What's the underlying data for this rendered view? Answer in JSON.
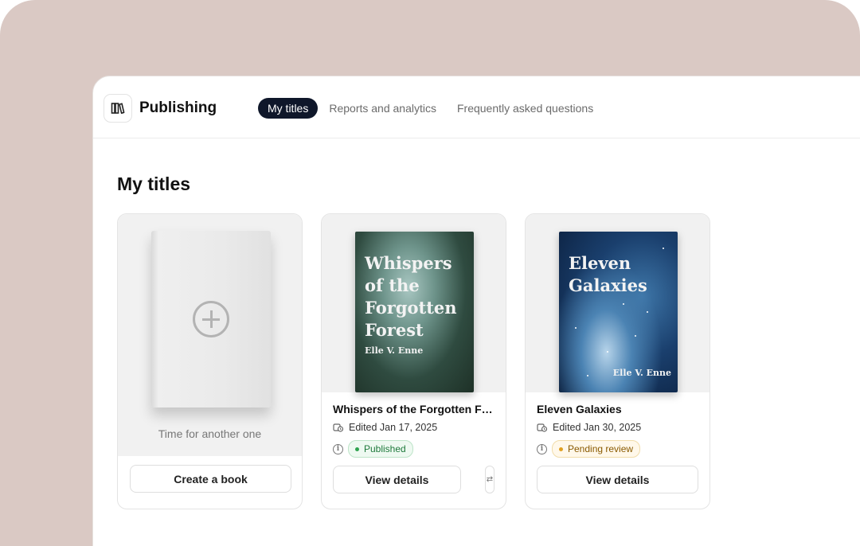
{
  "app": {
    "name": "Publishing",
    "logo_icon": "library-books-icon"
  },
  "nav": {
    "tabs": [
      {
        "label": "My titles",
        "active": true
      },
      {
        "label": "Reports and analytics",
        "active": false
      },
      {
        "label": "Frequently asked questions",
        "active": false
      }
    ]
  },
  "page": {
    "title": "My titles"
  },
  "new_book_card": {
    "caption": "Time for another one",
    "button_label": "Create a book",
    "icon": "plus-circle-icon"
  },
  "books": [
    {
      "cover_title": "Whispers of the Forgotten Forest",
      "cover_author": "Elle V. Enne",
      "title": "Whispers of the Forgotten Fo...",
      "edited": "Edited Jan 17, 2025",
      "status": "Published",
      "status_color": "#2fa34f",
      "button_label": "View details"
    },
    {
      "cover_title": "Eleven Galaxies",
      "cover_author": "Elle V. Enne",
      "title": "Eleven Galaxies",
      "edited": "Edited Jan 30, 2025",
      "status": "Pending review",
      "status_color": "#e0a020",
      "button_label": "View details"
    }
  ],
  "colors": {
    "frame_background": "#dac9c4",
    "active_tab": "#0f172a"
  }
}
